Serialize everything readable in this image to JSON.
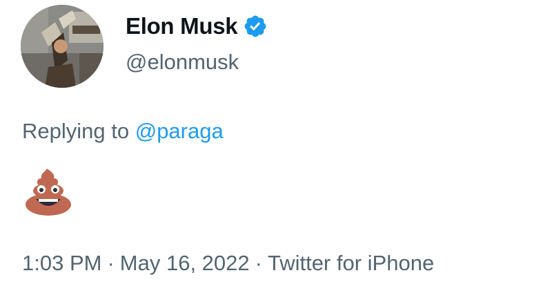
{
  "author": {
    "display_name": "Elon Musk",
    "handle": "@elonmusk",
    "verified": true,
    "avatar_icon": "profile-photo"
  },
  "reply": {
    "prefix": "Replying to",
    "mention": "@paraga"
  },
  "content": {
    "emoji_icon": "pile-of-poo-emoji"
  },
  "meta": {
    "time": "1:03 PM",
    "separator": "·",
    "date": "May 16, 2022",
    "source": "Twitter for iPhone"
  },
  "colors": {
    "text_primary": "#0f1419",
    "text_secondary": "#536471",
    "accent": "#1d9bf0"
  }
}
